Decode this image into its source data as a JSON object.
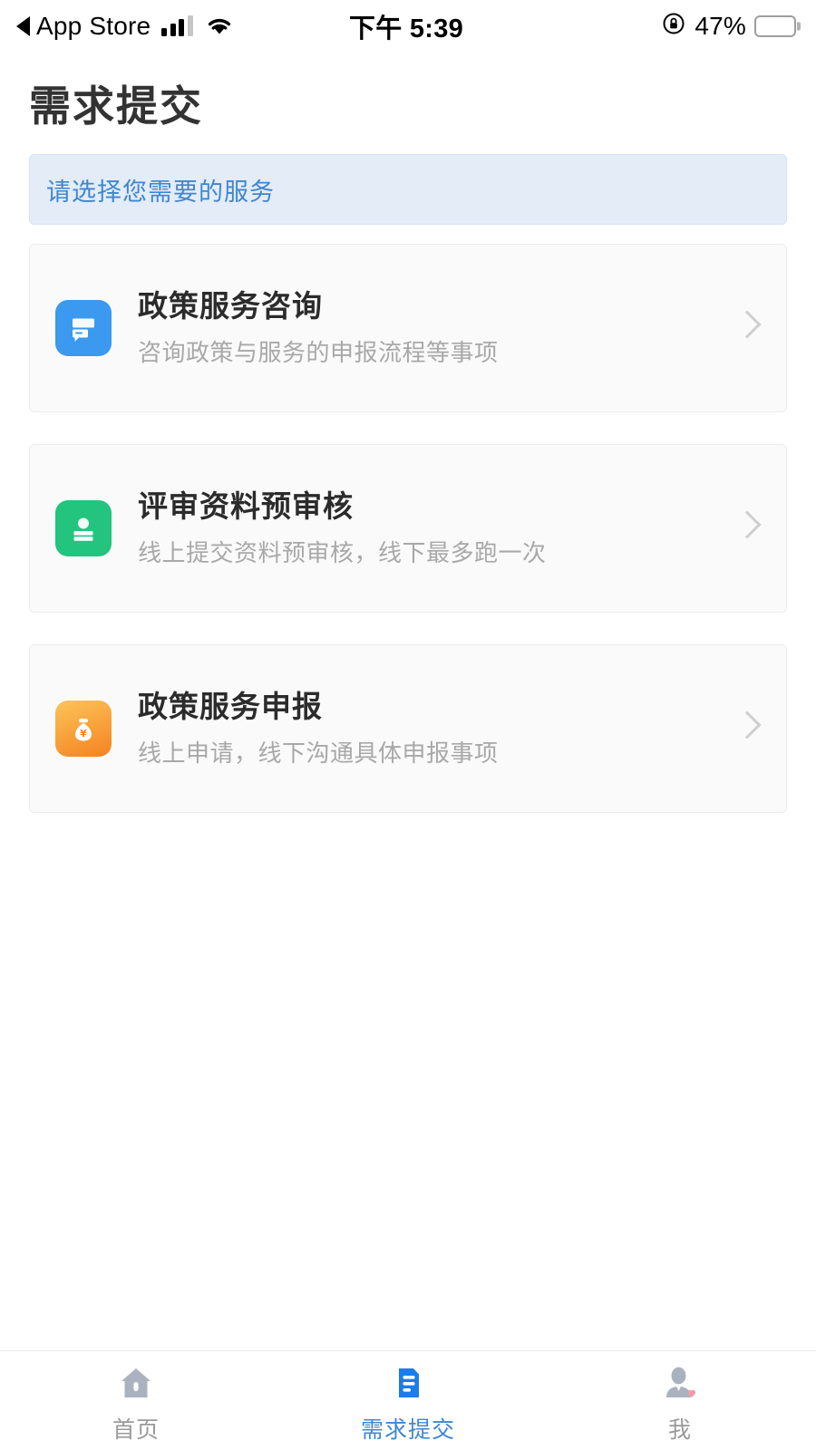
{
  "status_bar": {
    "back_label": "App Store",
    "back_icon": "back-triangle-icon",
    "signal_icon": "cellular-signal-icon",
    "signal_bars_filled": 3,
    "signal_bars_total": 4,
    "wifi_icon": "wifi-icon",
    "time": "下午 5:39",
    "rotation_lock_icon": "rotation-lock-icon",
    "battery_percent": "47%",
    "battery_level": 47,
    "battery_icon": "battery-icon"
  },
  "header": {
    "title": "需求提交"
  },
  "notice": {
    "text": "请选择您需要的服务",
    "text_color": "#3f86d1",
    "background_color": "#e3ecf7"
  },
  "services": [
    {
      "title": "政策服务咨询",
      "subtitle": "咨询政策与服务的申报流程等事项",
      "icon": "chat-message-icon",
      "icon_color": "#3b99f0",
      "chevron": "chevron-right-icon"
    },
    {
      "title": "评审资料预审核",
      "subtitle": "线上提交资料预审核，线下最多跑一次",
      "icon": "id-card-icon",
      "icon_color": "#22c47e",
      "chevron": "chevron-right-icon"
    },
    {
      "title": "政策服务申报",
      "subtitle": "线上申请，线下沟通具体申报事项",
      "icon": "money-bag-icon",
      "icon_color": "#f58220",
      "chevron": "chevron-right-icon"
    }
  ],
  "tab_bar": {
    "active_color": "#3f86d1",
    "inactive_color": "#9a9a9a",
    "tabs": [
      {
        "label": "首页",
        "icon": "home-icon",
        "active": false
      },
      {
        "label": "需求提交",
        "icon": "document-icon",
        "active": true
      },
      {
        "label": "我",
        "icon": "profile-person-icon",
        "active": false
      }
    ]
  }
}
